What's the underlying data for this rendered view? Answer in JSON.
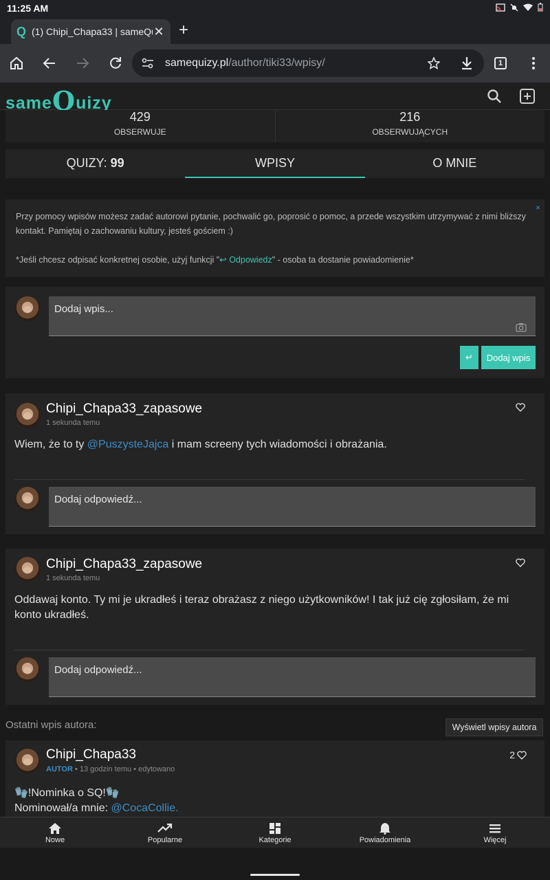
{
  "status": {
    "time": "11:25 AM"
  },
  "browser": {
    "tab_title": "(1) Chipi_Chapa33 | sameQu",
    "tab_count": "1",
    "url_domain": "samequizy.pl",
    "url_path": "/author/tiki33/wpisy/"
  },
  "site": {
    "logo_left": "same",
    "logo_q": "Q",
    "logo_right": "uizy"
  },
  "stats": [
    {
      "value": "429",
      "label": "OBSERWUJE"
    },
    {
      "value": "216",
      "label": "OBSERWUJĄCYCH"
    }
  ],
  "tabs": {
    "quizy_label": "QUIZY:",
    "quizy_count": "99",
    "wpisy": "WPISY",
    "o_mnie": "O MNIE"
  },
  "info": {
    "line1": "Przy pomocy wpisów możesz zadać autorowi pytanie, pochwalić go, poprosić o pomoc, a przede wszystkim utrzymywać z nimi bliższy kontakt. Pamiętaj o zachowaniu kultury, jesteś gościem :)",
    "line2_pre": "*Jeśli chcesz odpisać konkretnej osobie, użyj funkcji \"",
    "line2_link": "↩ Odpowiedz",
    "line2_post": "\" - osoba ta dostanie powiadomienie*",
    "close": "×"
  },
  "add_post": {
    "placeholder": "Dodaj wpis...",
    "submit": "Dodaj wpis",
    "enter_icon": "↵"
  },
  "posts": [
    {
      "author": "Chipi_Chapa33_zapasowe",
      "time": "1 sekunda temu",
      "body_pre": "Wiem, że to ty ",
      "mention": "@PuszysteJajca",
      "body_post": " i mam screeny tych wiadomości i obrażania.",
      "reply_placeholder": "Dodaj odpowiedź..."
    },
    {
      "author": "Chipi_Chapa33_zapasowe",
      "time": "1 sekunda temu",
      "body": "Oddawaj konto. Ty mi je ukradłeś i teraz obrażasz z niego użytkowników! I tak już cię zgłosiłam, że mi konto ukradłeś.",
      "reply_placeholder": "Dodaj odpowiedź..."
    }
  ],
  "last_post": {
    "section_label": "Ostatni wpis autora:",
    "view_button": "Wyświetl wpisy autora",
    "author": "Chipi_Chapa33",
    "badge": "AUTOR",
    "time": "13 godzin temu",
    "edited": "edytowano",
    "likes": "2",
    "line1": "🧤!Nominka o SQ!🧤",
    "line2_pre": "Nominował/a mnie: ",
    "line2_mention": "@CocaCollie."
  },
  "bottom_nav": [
    "Nowe",
    "Popularne",
    "Kategorie",
    "Powiadomienia",
    "Więcej"
  ],
  "colors": {
    "accent": "#3cc6b1",
    "mention": "#3c8dc6"
  }
}
